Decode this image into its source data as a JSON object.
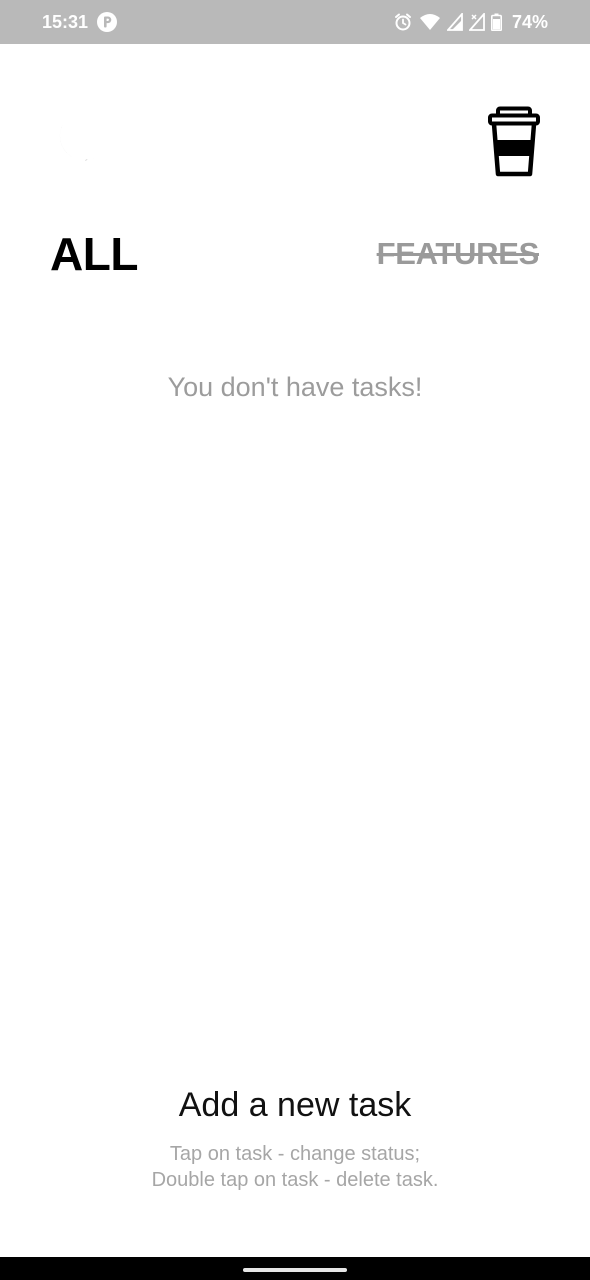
{
  "status_bar": {
    "time": "15:31",
    "app_icon": "p-badge-icon",
    "icons": [
      "alarm-icon",
      "wifi-icon",
      "signal-r-icon",
      "signal-x-icon",
      "battery-icon"
    ],
    "battery": "74%"
  },
  "header": {
    "theme_icon": "moon-icon",
    "cup_icon": "coffee-cup-icon"
  },
  "tabs": {
    "all": "ALL",
    "features": "FEATURES"
  },
  "main": {
    "empty_message": "You don't have tasks!"
  },
  "footer": {
    "add_task": "Add a new task",
    "hint_line1": "Tap on task - change status;",
    "hint_line2": "Double tap on task - delete task."
  },
  "colors": {
    "status_bar_bg": "#b9b9b9",
    "primary_text": "#000000",
    "muted_text": "#9c9c9c",
    "background": "#ffffff"
  }
}
